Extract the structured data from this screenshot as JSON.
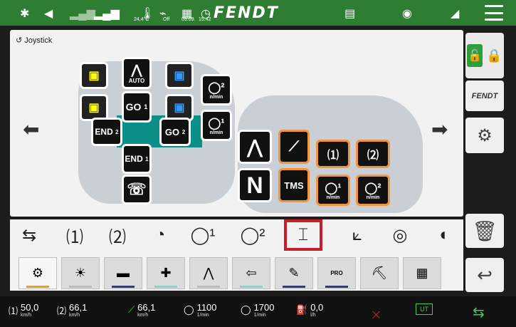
{
  "status": {
    "brand": "FENDT",
    "temperature": "24,4°C",
    "mode": "Off",
    "date": "03.09.",
    "time": "15:42"
  },
  "panel": {
    "title": "Joystick",
    "buttons": {
      "auto": "AUTO",
      "go1": "GO",
      "go1_num": "1",
      "go2": "GO",
      "go2_num": "2",
      "end2": "END",
      "end2_num": "2",
      "end1": "END",
      "end1_num": "1",
      "rpm_unit": "n/min",
      "n": "N",
      "tms": "TMS"
    }
  },
  "tabs": {
    "pro": "PRO"
  },
  "bottom": {
    "speed1": "50,0",
    "speed1_unit": "km/h",
    "speed2": "66,1",
    "speed2_unit": "km/h",
    "speed3": "66,1",
    "speed3_unit": "km/h",
    "rpm1": "1100",
    "rpm1_unit": "1/min",
    "rpm2": "1700",
    "rpm2_unit": "1/min",
    "fuel": "0,0",
    "fuel_unit": "l/h",
    "ut": "UT"
  },
  "colors": {
    "accent": "#2f7d32",
    "selected": "#c51f2a",
    "orange": "#f0953d"
  }
}
